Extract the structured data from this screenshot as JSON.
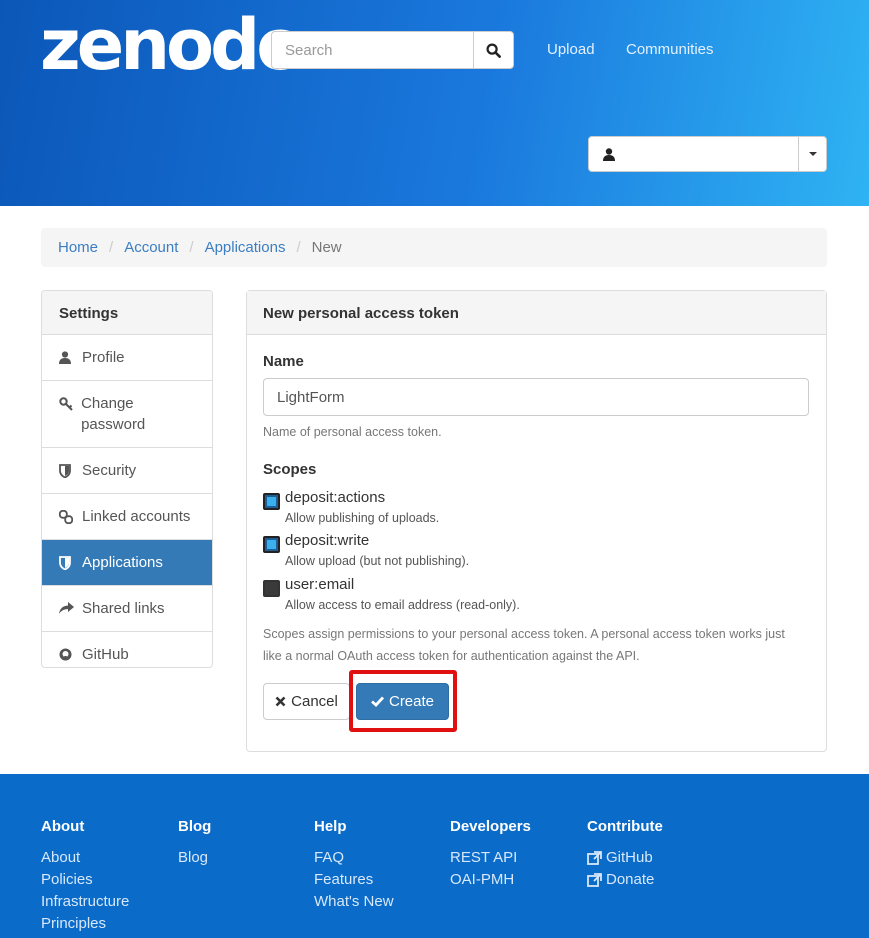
{
  "header": {
    "logo": "zenodo",
    "search_placeholder": "Search",
    "nav": [
      "Upload",
      "Communities"
    ]
  },
  "breadcrumb": [
    "Home",
    "Account",
    "Applications",
    "New"
  ],
  "sidebar": {
    "title": "Settings",
    "items": [
      {
        "label": "Profile",
        "icon": "user-icon"
      },
      {
        "label": "Change password",
        "icon": "key-icon"
      },
      {
        "label": "Security",
        "icon": "shield-icon"
      },
      {
        "label": "Linked accounts",
        "icon": "link-icon"
      },
      {
        "label": "Applications",
        "icon": "shield-icon",
        "active": true
      },
      {
        "label": "Shared links",
        "icon": "share-icon"
      },
      {
        "label": "GitHub",
        "icon": "github-icon"
      }
    ]
  },
  "panel": {
    "title": "New personal access token",
    "name_label": "Name",
    "name_value": "LightForm",
    "name_help": "Name of personal access token.",
    "scopes_label": "Scopes",
    "scopes": [
      {
        "title": "deposit:actions",
        "desc": "Allow publishing of uploads.",
        "checked": true
      },
      {
        "title": "deposit:write",
        "desc": "Allow upload (but not publishing).",
        "checked": true
      },
      {
        "title": "user:email",
        "desc": "Allow access to email address (read-only).",
        "checked": false
      }
    ],
    "scopes_help_1": "Scopes assign permissions to your personal access token. A personal access token works just",
    "scopes_help_2": "like a normal OAuth access token for authentication against the API.",
    "cancel_label": "Cancel",
    "create_label": "Create"
  },
  "footer": {
    "columns": [
      {
        "title": "About",
        "links": [
          "About",
          "Policies",
          "Infrastructure",
          "Principles"
        ]
      },
      {
        "title": "Blog",
        "links": [
          "Blog"
        ]
      },
      {
        "title": "Help",
        "links": [
          "FAQ",
          "Features",
          "What's New"
        ]
      },
      {
        "title": "Developers",
        "links": [
          "REST API",
          "OAI-PMH"
        ]
      },
      {
        "title": "Contribute",
        "links": [
          "GitHub",
          "Donate"
        ]
      }
    ]
  },
  "colors": {
    "accent": "#337ab7",
    "link": "#3b7ec2",
    "footer_bg": "#0b6bc9",
    "highlight": "#e01010"
  }
}
